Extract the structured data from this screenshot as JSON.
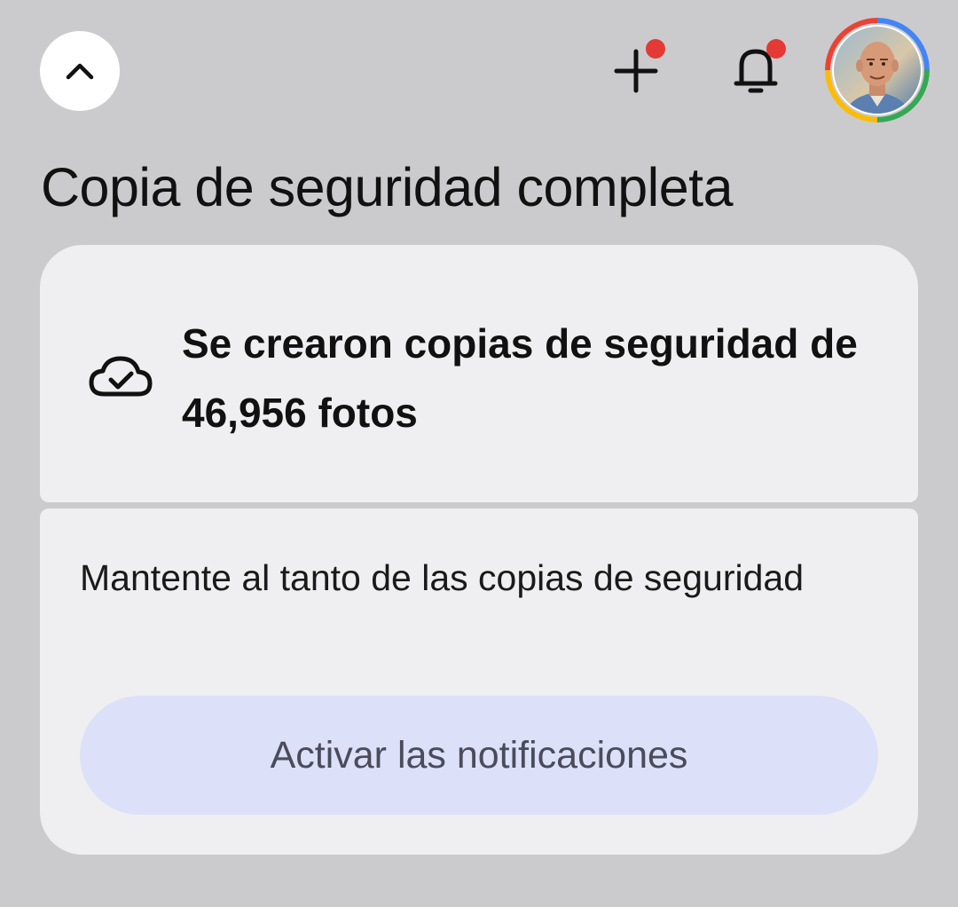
{
  "header": {
    "collapse_icon": "chevron-up-icon",
    "add_icon": "plus-icon",
    "notifications_icon": "bell-icon",
    "badge_color": "#e53935",
    "avatar_icon": "account-avatar"
  },
  "title": "Copia de seguridad completa",
  "backup_card": {
    "icon": "cloud-done-icon",
    "message": "Se crearon copias de seguridad de 46,956 fotos"
  },
  "notify_card": {
    "text": "Mantente al tanto de las copias de seguridad",
    "button_label": "Activar las notificaciones",
    "button_color": "#dce1f9"
  }
}
